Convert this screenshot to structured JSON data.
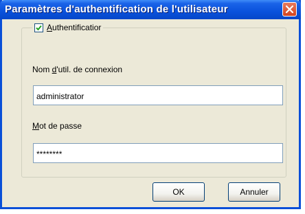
{
  "window": {
    "title": "Paramètres d'authentification de l'utilisateur"
  },
  "auth_checkbox": {
    "label_first": "A",
    "label_rest": "uthentificatior",
    "checked": true
  },
  "username": {
    "label_before": "Nom ",
    "label_mnemonic": "d",
    "label_after": "'util. de connexion",
    "value": "administrator"
  },
  "password": {
    "label_mnemonic": "M",
    "label_after": "ot de passe",
    "value": "********"
  },
  "buttons": {
    "ok": "OK",
    "cancel": "Annuler"
  }
}
